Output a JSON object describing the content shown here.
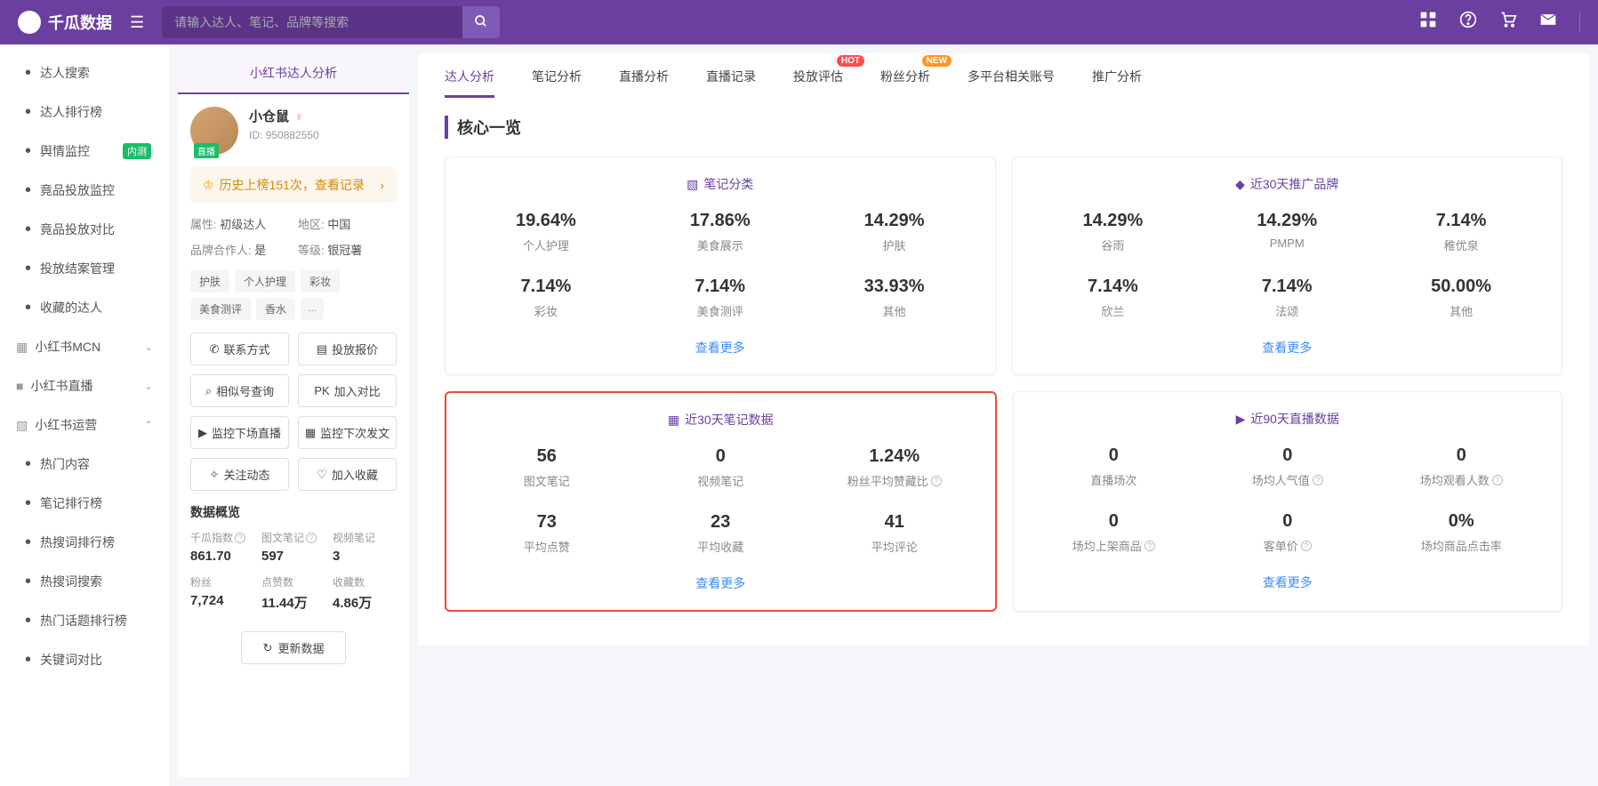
{
  "header": {
    "brand": "千瓜数据",
    "search_placeholder": "请输入达人、笔记、品牌等搜索"
  },
  "sidebar": {
    "items": [
      {
        "label": "达人搜索"
      },
      {
        "label": "达人排行榜"
      },
      {
        "label": "舆情监控",
        "tag": "内测"
      },
      {
        "label": "竟品投放监控"
      },
      {
        "label": "竟品投放对比"
      },
      {
        "label": "投放结案管理"
      },
      {
        "label": "收藏的达人"
      }
    ],
    "groups": [
      {
        "label": "小红书MCN",
        "open": false
      },
      {
        "label": "小红书直播",
        "open": false
      },
      {
        "label": "小红书运营",
        "open": true
      }
    ],
    "subitems": [
      {
        "label": "热门内容"
      },
      {
        "label": "笔记排行榜"
      },
      {
        "label": "热搜词排行榜"
      },
      {
        "label": "热搜词搜索"
      },
      {
        "label": "热门话题排行榜"
      },
      {
        "label": "关键词对比"
      }
    ]
  },
  "profile": {
    "tab": "小红书达人分析",
    "name": "小仓鼠",
    "id_label": "ID:",
    "id": "950882550",
    "live_tag": "直播",
    "history_count": "历史上榜151次，查看记录",
    "meta": {
      "attr_label": "属性:",
      "attr_value": "初级达人",
      "region_label": "地区:",
      "region_value": "中国",
      "partner_label": "品牌合作人:",
      "partner_value": "是",
      "level_label": "等级:",
      "level_value": "银冠薯"
    },
    "tags": [
      "护肤",
      "个人护理",
      "彩妆",
      "美食测评",
      "香水"
    ],
    "tags_more": "...",
    "buttons": {
      "contact": "联系方式",
      "quote": "投放报价",
      "similar": "相似号查询",
      "compare": "加入对比",
      "compare_prefix": "PK",
      "watch_live": "监控下场直播",
      "watch_post": "监控下次发文",
      "follow_trend": "关注动态",
      "favorite": "加入收藏"
    },
    "overview_title": "数据概览",
    "overview": [
      {
        "label": "千瓜指数",
        "value": "861.70",
        "help": true
      },
      {
        "label": "图文笔记",
        "value": "597",
        "help": true
      },
      {
        "label": "视频笔记",
        "value": "3"
      },
      {
        "label": "粉丝",
        "value": "7,724"
      },
      {
        "label": "点赞数",
        "value": "11.44万"
      },
      {
        "label": "收藏数",
        "value": "4.86万"
      }
    ],
    "update_btn": "更新数据"
  },
  "tabs": [
    "达人分析",
    "笔记分析",
    "直播分析",
    "直播记录",
    "投放评估",
    "粉丝分析",
    "多平台相关账号",
    "推广分析"
  ],
  "tab_badges": {
    "4": "HOT",
    "5": "NEW"
  },
  "section_title": "核心一览",
  "cards": {
    "notes_class": {
      "title": "笔记分类",
      "stats": [
        {
          "v": "19.64%",
          "l": "个人护理"
        },
        {
          "v": "17.86%",
          "l": "美食展示"
        },
        {
          "v": "14.29%",
          "l": "护肤"
        },
        {
          "v": "7.14%",
          "l": "彩妆"
        },
        {
          "v": "7.14%",
          "l": "美食测评"
        },
        {
          "v": "33.93%",
          "l": "其他"
        }
      ],
      "more": "查看更多"
    },
    "brands_30d": {
      "title": "近30天推广品牌",
      "stats": [
        {
          "v": "14.29%",
          "l": "谷雨"
        },
        {
          "v": "14.29%",
          "l": "PMPM"
        },
        {
          "v": "7.14%",
          "l": "稚优泉"
        },
        {
          "v": "7.14%",
          "l": "欣兰"
        },
        {
          "v": "7.14%",
          "l": "法颂"
        },
        {
          "v": "50.00%",
          "l": "其他"
        }
      ],
      "more": "查看更多"
    },
    "notes_30d": {
      "title": "近30天笔记数据",
      "stats": [
        {
          "v": "56",
          "l": "图文笔记"
        },
        {
          "v": "0",
          "l": "视频笔记"
        },
        {
          "v": "1.24%",
          "l": "粉丝平均赞藏比",
          "help": true
        },
        {
          "v": "73",
          "l": "平均点赞"
        },
        {
          "v": "23",
          "l": "平均收藏"
        },
        {
          "v": "41",
          "l": "平均评论"
        }
      ],
      "more": "查看更多"
    },
    "live_90d": {
      "title": "近90天直播数据",
      "stats": [
        {
          "v": "0",
          "l": "直播场次"
        },
        {
          "v": "0",
          "l": "场均人气值",
          "help": true
        },
        {
          "v": "0",
          "l": "场均观看人数",
          "help": true
        },
        {
          "v": "0",
          "l": "场均上架商品",
          "help": true
        },
        {
          "v": "0",
          "l": "客单价",
          "help": true
        },
        {
          "v": "0%",
          "l": "场均商品点击率"
        }
      ],
      "more": "查看更多"
    }
  }
}
